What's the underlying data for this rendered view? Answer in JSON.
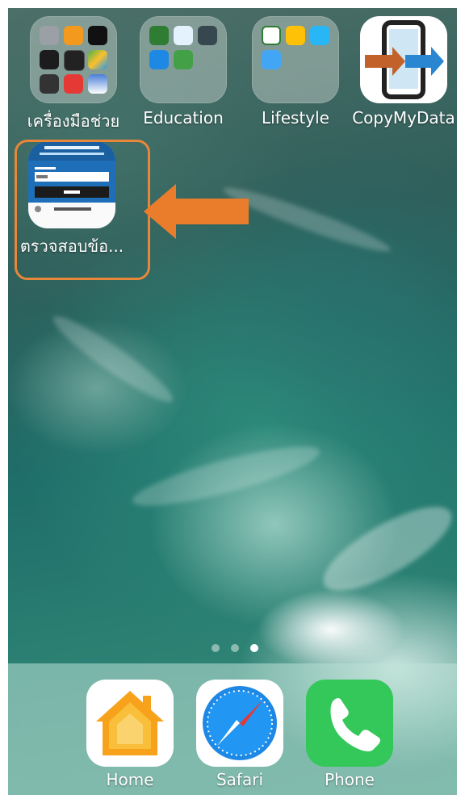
{
  "home_screen": {
    "apps": [
      {
        "id": "folder-tools",
        "label": "เครื่องมือช่วย",
        "type": "folder"
      },
      {
        "id": "folder-education",
        "label": "Education",
        "type": "folder"
      },
      {
        "id": "folder-lifestyle",
        "label": "Lifestyle",
        "type": "folder"
      },
      {
        "id": "app-copymydata",
        "label": "CopyMyData",
        "type": "app"
      },
      {
        "id": "app-check",
        "label": "ตรวจสอบข้อ...",
        "type": "app",
        "highlighted": true,
        "preview": {
          "header_line1": "โรงเรียนเตรียมอุดมศึกษา",
          "header_line2": "นครราชสีมา",
          "field_label": "ชื่อผู้ใช้งาน",
          "field_value": "6298",
          "button": "ตกลง",
          "footer": "ค้นหา...ครูที่ปรึกษา"
        }
      }
    ],
    "folder_icons": {
      "tools": [
        "contacts-icon",
        "calculator-icon",
        "clock-icon",
        "voice-memos-icon",
        "calendar-icon",
        "maps-icon",
        "brush-icon",
        "acrobat-icon",
        "photos-icon"
      ],
      "education": [
        "green-book-icon",
        "obec-icon",
        "starburst-icon",
        "checklist-icon",
        "check-circle-icon"
      ],
      "lifestyle": [
        "seven-eleven-icon",
        "food-icon",
        "bird-icon",
        "blue-logo-icon"
      ]
    },
    "page_indicator": {
      "pages": 3,
      "current": 3
    },
    "colors": {
      "highlight": "#e8873a",
      "arrow": "#ea7d2c"
    }
  },
  "dock": {
    "apps": [
      {
        "id": "home",
        "label": "Home"
      },
      {
        "id": "safari",
        "label": "Safari"
      },
      {
        "id": "phone",
        "label": "Phone"
      }
    ]
  }
}
